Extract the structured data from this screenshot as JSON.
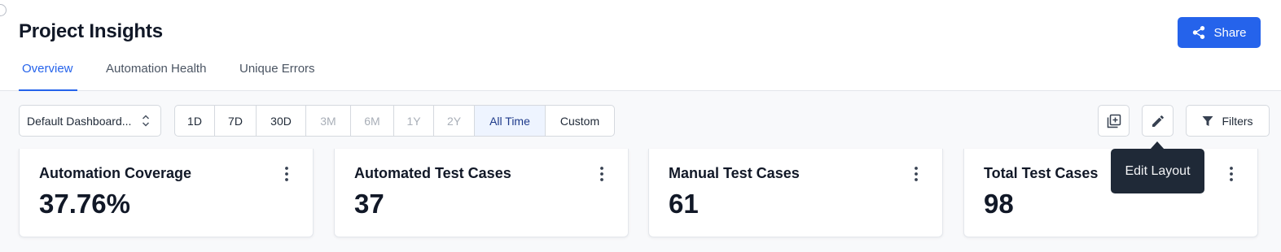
{
  "header": {
    "title": "Project Insights",
    "share_label": "Share"
  },
  "tabs": [
    {
      "label": "Overview",
      "active": true
    },
    {
      "label": "Automation Health",
      "active": false
    },
    {
      "label": "Unique Errors",
      "active": false
    }
  ],
  "toolbar": {
    "dashboard_select": "Default Dashboard...",
    "time_ranges": [
      {
        "label": "1D",
        "state": "enabled"
      },
      {
        "label": "7D",
        "state": "enabled"
      },
      {
        "label": "30D",
        "state": "enabled"
      },
      {
        "label": "3M",
        "state": "disabled"
      },
      {
        "label": "6M",
        "state": "disabled"
      },
      {
        "label": "1Y",
        "state": "disabled"
      },
      {
        "label": "2Y",
        "state": "disabled"
      },
      {
        "label": "All Time",
        "state": "selected"
      },
      {
        "label": "Custom",
        "state": "enabled"
      }
    ],
    "filters_label": "Filters",
    "tooltip": "Edit Layout"
  },
  "cards": [
    {
      "title": "Automation Coverage",
      "value": "37.76%"
    },
    {
      "title": "Automated Test Cases",
      "value": "37"
    },
    {
      "title": "Manual Test Cases",
      "value": "61"
    },
    {
      "title": "Total Test Cases",
      "value": "98"
    }
  ],
  "colors": {
    "accent": "#2563eb",
    "tooltip_bg": "#1f2937",
    "selected_range_bg": "#eef4ff"
  },
  "icons": {
    "share": "share-icon",
    "select": "chevron-up-down-icon",
    "add_widget": "add-widget-icon",
    "edit": "pencil-icon",
    "filter": "filter-icon",
    "card_menu": "kebab-menu-icon"
  }
}
